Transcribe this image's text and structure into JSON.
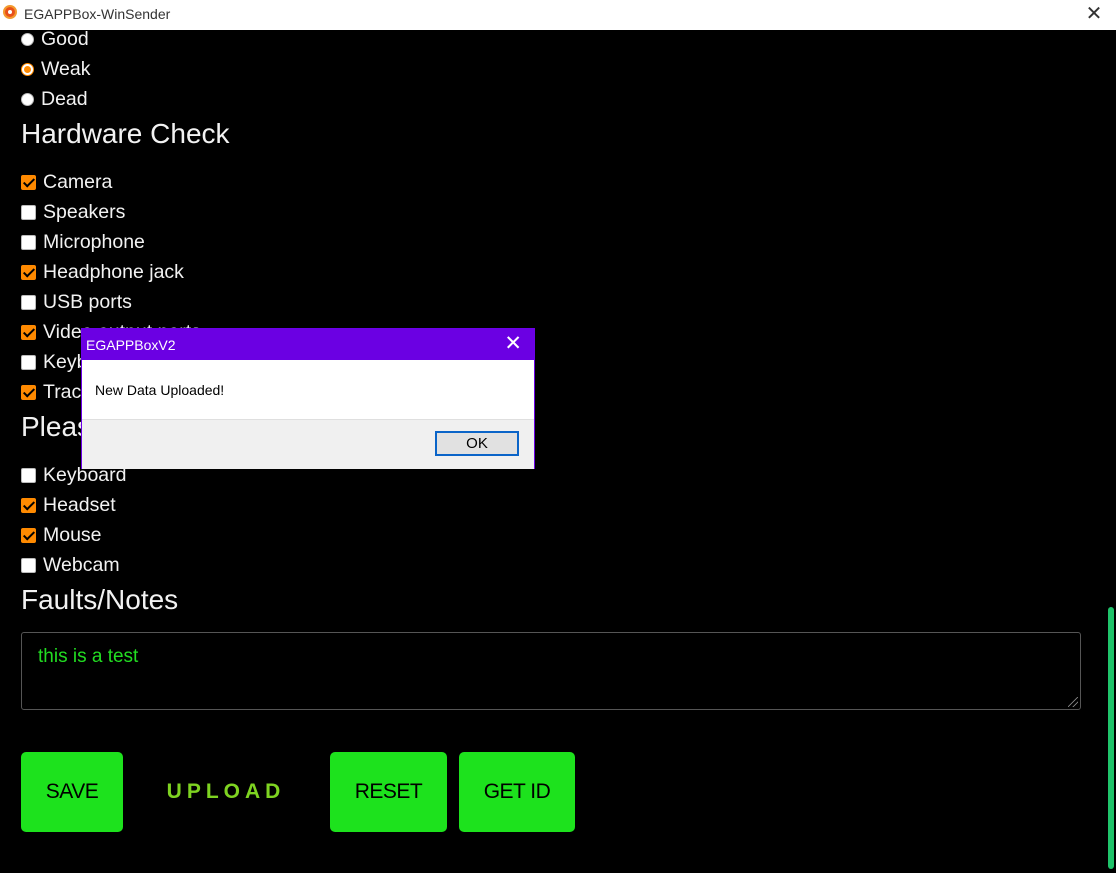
{
  "window": {
    "title": "EGAPPBox-WinSender",
    "close_symbol": "✕"
  },
  "condition": {
    "options": [
      {
        "label": "Good",
        "selected": false
      },
      {
        "label": "Weak",
        "selected": true
      },
      {
        "label": "Dead",
        "selected": false
      }
    ]
  },
  "hardware": {
    "heading": "Hardware Check",
    "items": [
      {
        "label": "Camera",
        "checked": true
      },
      {
        "label": "Speakers",
        "checked": false
      },
      {
        "label": "Microphone",
        "checked": false
      },
      {
        "label": "Headphone jack",
        "checked": true
      },
      {
        "label": "USB ports",
        "checked": false
      },
      {
        "label": "Video output ports",
        "checked": true
      },
      {
        "label": "Keyboard",
        "checked": false
      },
      {
        "label": "Trackpad",
        "checked": true
      }
    ]
  },
  "peripherals": {
    "heading": "Please select peripherals",
    "items": [
      {
        "label": "Keyboard",
        "checked": false
      },
      {
        "label": "Headset",
        "checked": true
      },
      {
        "label": "Mouse",
        "checked": true
      },
      {
        "label": "Webcam",
        "checked": false
      }
    ]
  },
  "notes": {
    "heading": "Faults/Notes",
    "value": "this is a test"
  },
  "buttons": {
    "save": "SAVE",
    "upload": "UPLOAD",
    "reset": "RESET",
    "get_id": "GET ID"
  },
  "dialog": {
    "title": "EGAPPBoxV2",
    "close_symbol": "✕",
    "message": "New Data Uploaded!",
    "ok_label": "OK"
  },
  "colors": {
    "accent_orange": "#ff8a00",
    "button_green": "#1de21d",
    "dialog_purple": "#6b00e3",
    "notes_text": "#22dd22"
  }
}
